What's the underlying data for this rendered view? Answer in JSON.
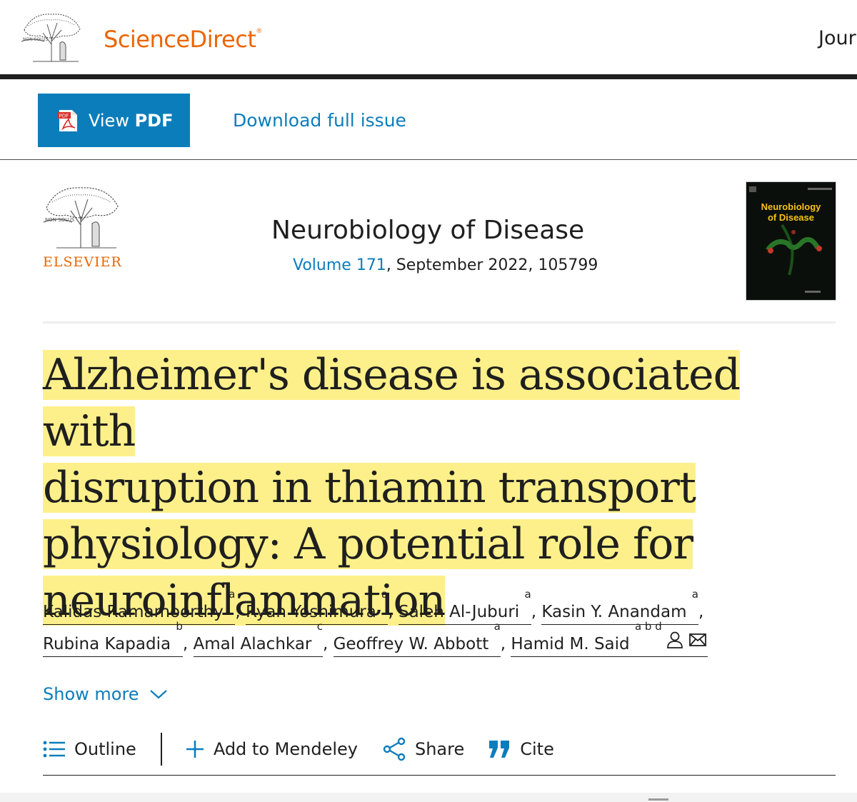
{
  "header": {
    "brand": "ScienceDirect",
    "brand_mark": "®",
    "journals_link": "Jour",
    "logo_text": "NON SOLUS"
  },
  "actions": {
    "view_pdf_prefix": "View ",
    "view_pdf_bold": "PDF",
    "pdf_icon_text": "PDF",
    "download_full_issue": "Download full issue"
  },
  "publication": {
    "publisher": "ELSEVIER",
    "journal_title": "Neurobiology of Disease",
    "volume_link": "Volume 171",
    "volume_rest": ", September 2022, 105799",
    "cover_title_line1": "Neurobiology",
    "cover_title_line2": "of Disease"
  },
  "article": {
    "title_lines": [
      "Alzheimer's disease is associated with",
      "disruption in thiamin transport",
      "physiology: A potential role for",
      "neuroinflammation"
    ]
  },
  "authors": [
    {
      "name": "Kalidas Ramamoorthy",
      "aff": "a"
    },
    {
      "name": "Ryan Yoshimura",
      "aff": "a"
    },
    {
      "name": "Saleh Al-Juburi",
      "aff": "a"
    },
    {
      "name": "Kasin Y. Anandam",
      "aff": "a"
    },
    {
      "name": "Rubina Kapadia",
      "aff": "b"
    },
    {
      "name": "Amal Alachkar",
      "aff": "c"
    },
    {
      "name": "Geoffrey W. Abbott",
      "aff": "a"
    },
    {
      "name": "Hamid M. Said",
      "aff": "a b d"
    }
  ],
  "show_more": "Show more",
  "toolbar": {
    "outline": "Outline",
    "mendeley": "Add to Mendeley",
    "share": "Share",
    "cite": "Cite"
  },
  "colors": {
    "brand_orange": "#eb6500",
    "link_blue": "#0c7dbb",
    "pdf_button": "#0c7dbb",
    "title_highlight": "#fdf08a"
  },
  "icons": [
    "elsevier-tree-logo",
    "pdf-icon",
    "person-icon",
    "envelope-icon",
    "chevron-down-icon",
    "list-icon",
    "plus-icon",
    "share-icon",
    "quote-icon"
  ]
}
